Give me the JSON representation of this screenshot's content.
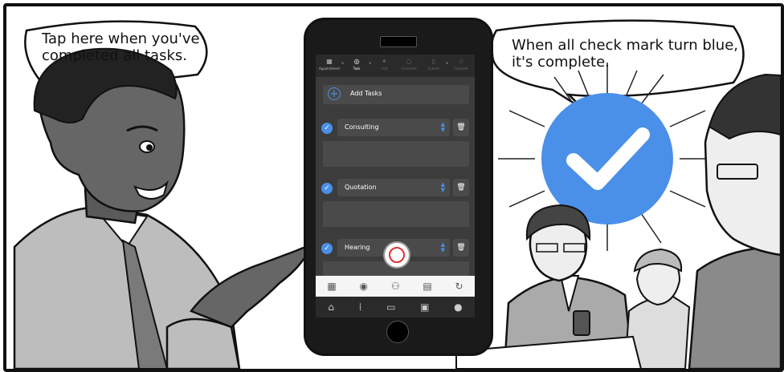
{
  "speech": {
    "left": "Tap here when you've\ncompleted all tasks.",
    "right": "When all check mark turn blue,\nit's complete."
  },
  "app": {
    "steps": [
      {
        "label": "Appointment",
        "icon": "calendar-icon"
      },
      {
        "label": "Task",
        "icon": "check-icon"
      },
      {
        "label": "Visit",
        "icon": "walk-icon"
      },
      {
        "label": "Comment",
        "icon": "chat-icon"
      },
      {
        "label": "Submit",
        "icon": "doc-icon"
      },
      {
        "label": "Evaluate",
        "icon": "star-icon"
      }
    ],
    "add_tasks_label": "Add Tasks",
    "tasks": [
      {
        "label": "Consulting",
        "checked": true
      },
      {
        "label": "Quotation",
        "checked": true
      },
      {
        "label": "Hearing",
        "checked": true
      }
    ],
    "accent_color": "#4a8fe8"
  }
}
